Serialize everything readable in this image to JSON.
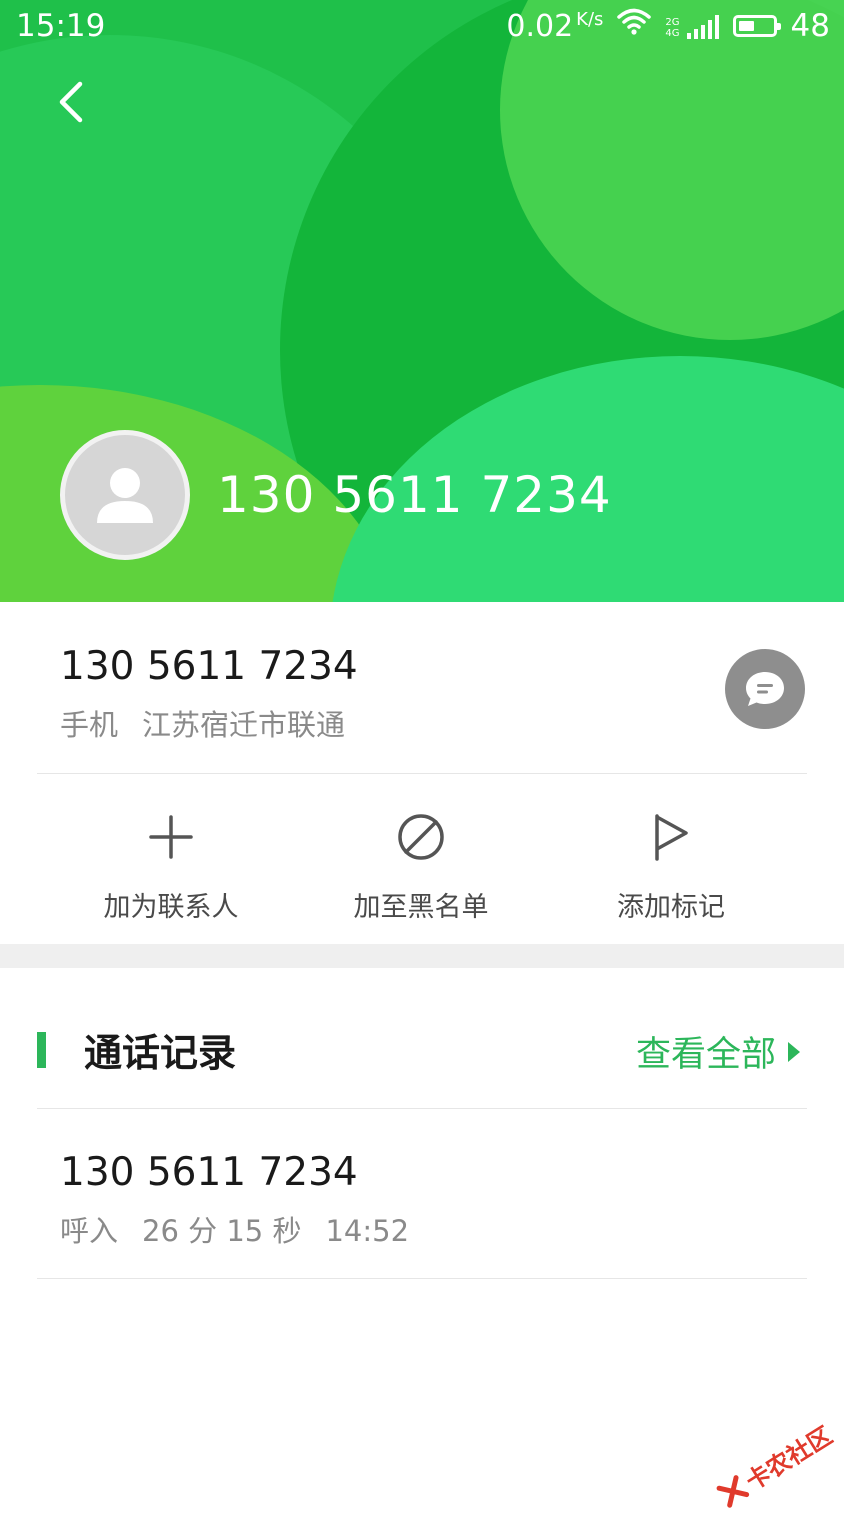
{
  "status_bar": {
    "time": "15:19",
    "net_speed": "0.02",
    "net_speed_unit": "K/s",
    "net_types": [
      "2G",
      "4G"
    ],
    "battery": "48",
    "battery_level_percent": 48
  },
  "header": {
    "number": "130 5611 7234"
  },
  "info": {
    "number": "130 5611 7234",
    "type": "手机",
    "location": "江苏宿迁市联通"
  },
  "actions": [
    {
      "label": "加为联系人",
      "icon": "plus-icon"
    },
    {
      "label": "加至黑名单",
      "icon": "block-icon"
    },
    {
      "label": "添加标记",
      "icon": "flag-icon"
    }
  ],
  "call_history": {
    "title": "通话记录",
    "view_all": "查看全部",
    "records": [
      {
        "number": "130 5611 7234",
        "direction": "呼入",
        "duration": "26 分 15 秒",
        "time": "14:52"
      }
    ]
  },
  "watermark": "卡农社区",
  "colors": {
    "accent": "#2cb65a",
    "header_green": "#1fc04a"
  }
}
